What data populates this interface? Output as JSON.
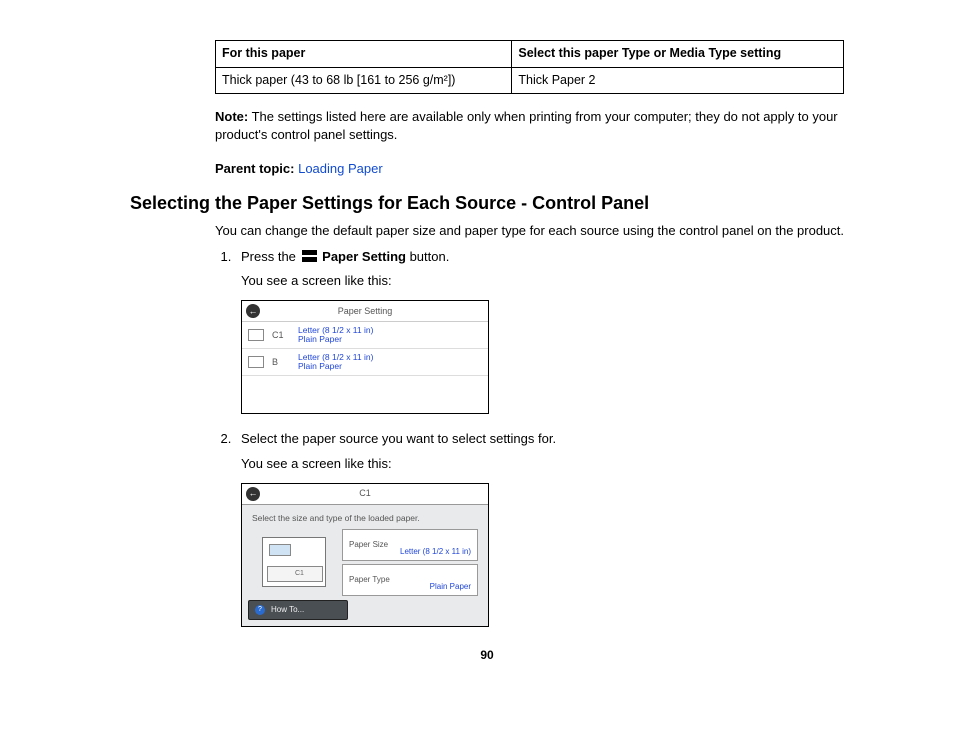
{
  "table": {
    "head": [
      "For this paper",
      "Select this paper Type or Media Type setting"
    ],
    "row": [
      "Thick paper (43 to 68 lb [161 to 256 g/m²])",
      "Thick Paper 2"
    ]
  },
  "note": {
    "label": "Note:",
    "text": " The settings listed here are available only when printing from your computer; they do not apply to your product's control panel settings."
  },
  "parent_topic": {
    "label": "Parent topic:",
    "link": "Loading Paper"
  },
  "heading": "Selecting the Paper Settings for Each Source - Control Panel",
  "intro": "You can change the default paper size and paper type for each source using the control panel on the product.",
  "step1": {
    "pre": "Press the ",
    "button_label": "Paper Setting",
    "post": " button.",
    "sub": "You see a screen like this:"
  },
  "screenshot1": {
    "title": "Paper Setting",
    "rows": [
      {
        "tray": "C1",
        "line1": "Letter (8 1/2 x 11 in)",
        "line2": "Plain Paper"
      },
      {
        "tray": "B",
        "line1": "Letter (8 1/2 x 11 in)",
        "line2": "Plain Paper"
      }
    ]
  },
  "step2": {
    "text": "Select the paper source you want to select settings for.",
    "sub": "You see a screen like this:"
  },
  "screenshot2": {
    "title": "C1",
    "prompt": "Select the size and type of the loaded paper.",
    "rows": [
      {
        "label": "Paper Size",
        "value": "Letter (8 1/2 x 11 in)"
      },
      {
        "label": "Paper Type",
        "value": "Plain Paper"
      }
    ],
    "howto": "How To..."
  },
  "page_number": "90"
}
